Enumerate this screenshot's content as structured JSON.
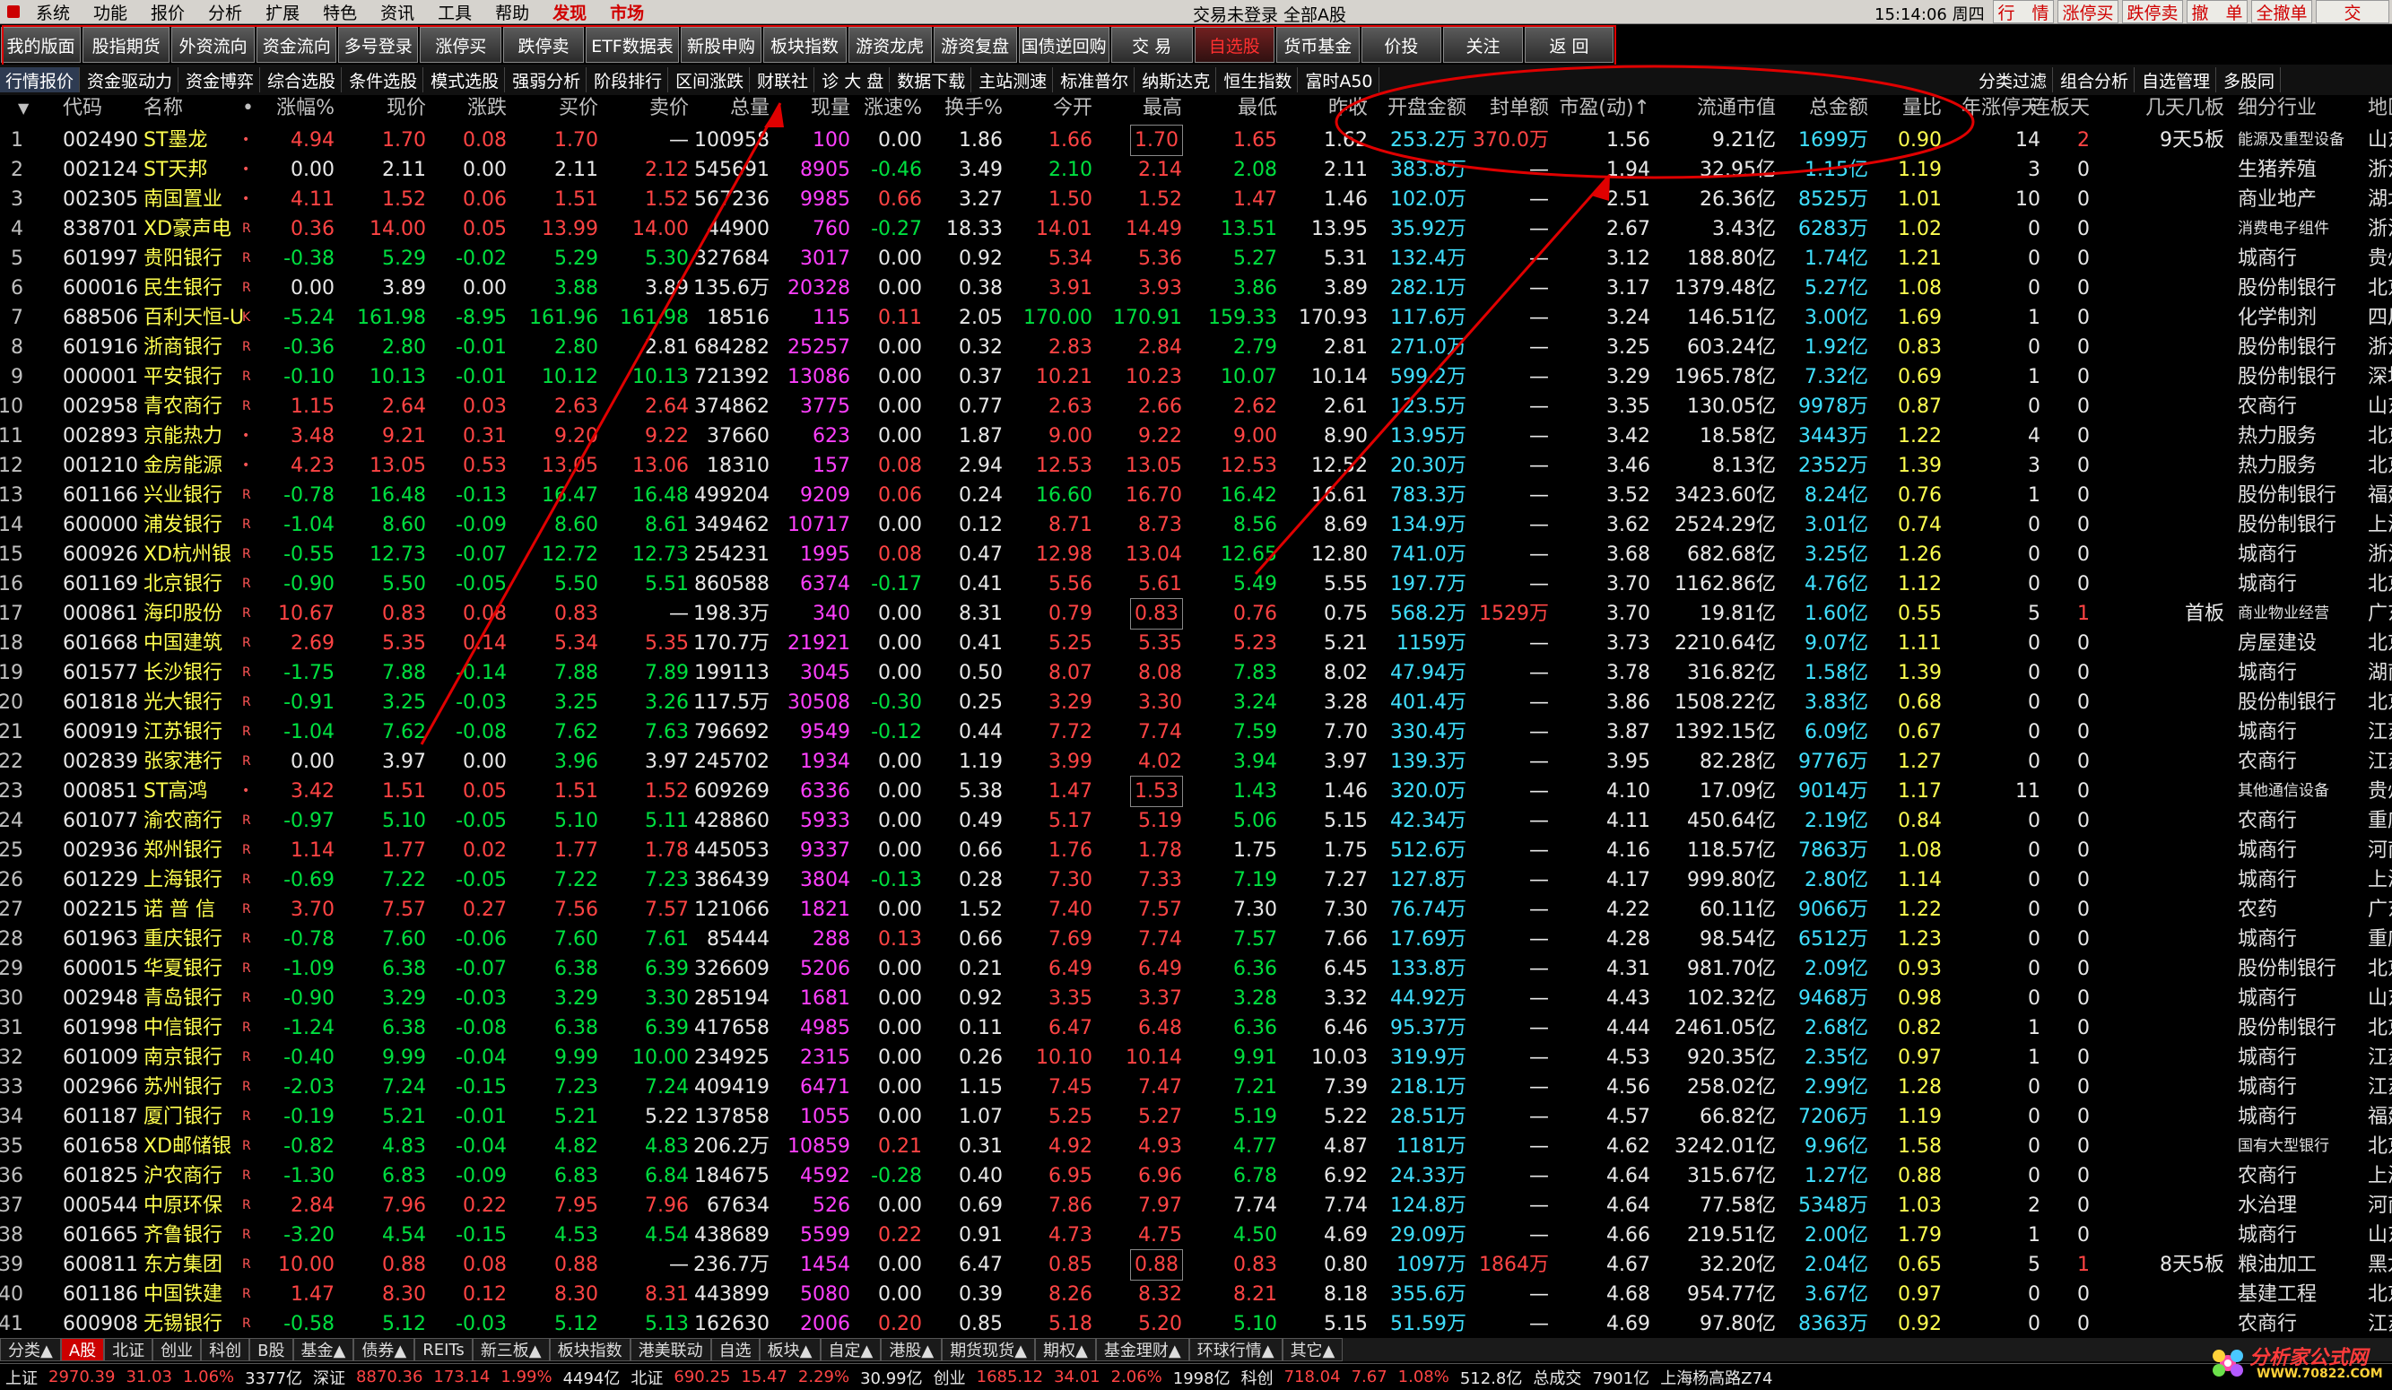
{
  "menubar": {
    "items": [
      "系统",
      "功能",
      "报价",
      "分析",
      "扩展",
      "特色",
      "资讯",
      "工具",
      "帮助",
      "发现",
      "市场"
    ],
    "red_items": [
      "发现",
      "市场"
    ],
    "title": "交易未登录  全部A股",
    "clock": "15:14:06 周四",
    "quick_buttons": [
      "行　情",
      "涨停买",
      "跌停卖",
      "撤　单",
      "全撤单",
      "交"
    ]
  },
  "toolbar1": {
    "buttons": [
      "我的版面",
      "股指期货",
      "外资流向",
      "资金流向",
      "多号登录",
      "涨停买",
      "跌停卖",
      "ETF数据表",
      "新股申购",
      "板块指数",
      "游资龙虎",
      "游资复盘",
      "国债逆回购",
      "交 易",
      "自选股",
      "货币基金",
      "价投",
      "关注",
      "返 回"
    ],
    "active": "自选股"
  },
  "toolbar2": {
    "buttons": [
      "行情报价",
      "资金驱动力",
      "资金博弈",
      "综合选股",
      "条件选股",
      "模式选股",
      "强弱分析",
      "阶段排行",
      "区间涨跌",
      "财联社",
      "诊 大 盘",
      "数据下载",
      "主站测速",
      "标准普尔",
      "纳斯达克",
      "恒生指数",
      "富时A50"
    ],
    "active": "行情报价",
    "right_buttons": [
      "分类过滤",
      "组合分析",
      "自选管理",
      "多股同"
    ]
  },
  "columns": [
    "",
    "代码",
    "名称",
    "•",
    "涨幅%",
    "现价",
    "涨跌",
    "买价",
    "卖价",
    "总量",
    "现量",
    "涨速%",
    "换手%",
    "今开",
    "最高",
    "最低",
    "昨收",
    "开盘金额",
    "封单额",
    "市盈(动)↑",
    "流通市值",
    "总金额",
    "量比",
    "年涨停天",
    "连板天",
    "几天几板",
    "细分行业",
    "地区"
  ],
  "rows": [
    [
      "1",
      "002490",
      "ST墨龙",
      "•",
      "4.94",
      "1.70",
      "0.08",
      "1.70",
      "—",
      "100958",
      "100",
      "0.00",
      "1.86",
      "1.66",
      "1.70",
      "1.65",
      "1.62",
      "253.2万",
      "370.0万",
      "1.56",
      "9.21亿",
      "1699万",
      "0.90",
      "14",
      "2",
      "9天5板",
      "能源及重型设备",
      "山东"
    ],
    [
      "2",
      "002124",
      "ST天邦",
      "•",
      "0.00",
      "2.11",
      "0.00",
      "2.11",
      "2.12",
      "545691",
      "8905",
      "-0.46",
      "3.49",
      "2.10",
      "2.14",
      "2.08",
      "2.11",
      "383.8万",
      "—",
      "1.94",
      "32.95亿",
      "1.15亿",
      "1.19",
      "3",
      "0",
      "",
      "生猪养殖",
      "浙江"
    ],
    [
      "3",
      "002305",
      "南国置业",
      "•",
      "4.11",
      "1.52",
      "0.06",
      "1.51",
      "1.52",
      "567236",
      "9985",
      "0.66",
      "3.27",
      "1.50",
      "1.52",
      "1.47",
      "1.46",
      "102.0万",
      "—",
      "2.51",
      "26.36亿",
      "8525万",
      "1.01",
      "10",
      "0",
      "",
      "商业地产",
      "湖北"
    ],
    [
      "4",
      "838701",
      "XD豪声电",
      "R",
      "0.36",
      "14.00",
      "0.05",
      "13.99",
      "14.00",
      "44900",
      "760",
      "-0.27",
      "18.33",
      "14.01",
      "14.49",
      "13.51",
      "13.95",
      "35.92万",
      "—",
      "2.67",
      "3.43亿",
      "6283万",
      "1.02",
      "0",
      "0",
      "",
      "消费电子组件",
      "浙江"
    ],
    [
      "5",
      "601997",
      "贵阳银行",
      "R",
      "-0.38",
      "5.29",
      "-0.02",
      "5.29",
      "5.30",
      "327684",
      "3017",
      "0.00",
      "0.92",
      "5.34",
      "5.36",
      "5.27",
      "5.31",
      "132.4万",
      "—",
      "3.12",
      "188.80亿",
      "1.74亿",
      "1.21",
      "0",
      "0",
      "",
      "城商行",
      "贵州"
    ],
    [
      "6",
      "600016",
      "民生银行",
      "R",
      "0.00",
      "3.89",
      "0.00",
      "3.88",
      "3.89",
      "135.6万",
      "20328",
      "0.00",
      "0.38",
      "3.91",
      "3.93",
      "3.86",
      "3.89",
      "282.1万",
      "—",
      "3.17",
      "1379.48亿",
      "5.27亿",
      "1.08",
      "0",
      "0",
      "",
      "股份制银行",
      "北京"
    ],
    [
      "7",
      "688506",
      "百利天恒-U",
      "K",
      "-5.24",
      "161.98",
      "-8.95",
      "161.96",
      "161.98",
      "18516",
      "115",
      "0.11",
      "2.05",
      "170.00",
      "170.91",
      "159.33",
      "170.93",
      "117.6万",
      "—",
      "3.24",
      "146.51亿",
      "3.00亿",
      "1.69",
      "1",
      "0",
      "",
      "化学制剂",
      "四川"
    ],
    [
      "8",
      "601916",
      "浙商银行",
      "R",
      "-0.36",
      "2.80",
      "-0.01",
      "2.80",
      "2.81",
      "684282",
      "25257",
      "0.00",
      "0.32",
      "2.83",
      "2.84",
      "2.79",
      "2.81",
      "271.0万",
      "—",
      "3.25",
      "603.24亿",
      "1.92亿",
      "0.83",
      "0",
      "0",
      "",
      "股份制银行",
      "浙江"
    ],
    [
      "9",
      "000001",
      "平安银行",
      "R",
      "-0.10",
      "10.13",
      "-0.01",
      "10.12",
      "10.13",
      "721392",
      "13086",
      "0.00",
      "0.37",
      "10.21",
      "10.23",
      "10.07",
      "10.14",
      "599.2万",
      "—",
      "3.29",
      "1965.78亿",
      "7.32亿",
      "0.69",
      "1",
      "0",
      "",
      "股份制银行",
      "深圳"
    ],
    [
      "10",
      "002958",
      "青农商行",
      "R",
      "1.15",
      "2.64",
      "0.03",
      "2.63",
      "2.64",
      "374862",
      "3775",
      "0.00",
      "0.77",
      "2.63",
      "2.66",
      "2.62",
      "2.61",
      "123.5万",
      "—",
      "3.35",
      "130.05亿",
      "9978万",
      "0.87",
      "0",
      "0",
      "",
      "农商行",
      "山东"
    ],
    [
      "11",
      "002893",
      "京能热力",
      "•",
      "3.48",
      "9.21",
      "0.31",
      "9.20",
      "9.22",
      "37660",
      "623",
      "0.00",
      "1.87",
      "9.00",
      "9.22",
      "9.00",
      "8.90",
      "13.95万",
      "—",
      "3.42",
      "18.58亿",
      "3443万",
      "1.22",
      "4",
      "0",
      "",
      "热力服务",
      "北京"
    ],
    [
      "12",
      "001210",
      "金房能源",
      "•",
      "4.23",
      "13.05",
      "0.53",
      "13.05",
      "13.06",
      "18310",
      "157",
      "0.08",
      "2.94",
      "12.53",
      "13.05",
      "12.53",
      "12.52",
      "20.30万",
      "—",
      "3.46",
      "8.13亿",
      "2352万",
      "1.39",
      "3",
      "0",
      "",
      "热力服务",
      "北京"
    ],
    [
      "13",
      "601166",
      "兴业银行",
      "R",
      "-0.78",
      "16.48",
      "-0.13",
      "16.47",
      "16.48",
      "499204",
      "9209",
      "0.06",
      "0.24",
      "16.60",
      "16.70",
      "16.42",
      "16.61",
      "783.3万",
      "—",
      "3.52",
      "3423.60亿",
      "8.24亿",
      "0.76",
      "1",
      "0",
      "",
      "股份制银行",
      "福建"
    ],
    [
      "14",
      "600000",
      "浦发银行",
      "R",
      "-1.04",
      "8.60",
      "-0.09",
      "8.60",
      "8.61",
      "349462",
      "10717",
      "0.00",
      "0.12",
      "8.71",
      "8.73",
      "8.56",
      "8.69",
      "134.9万",
      "—",
      "3.62",
      "2524.29亿",
      "3.01亿",
      "0.74",
      "0",
      "0",
      "",
      "股份制银行",
      "上海"
    ],
    [
      "15",
      "600926",
      "XD杭州银",
      "R",
      "-0.55",
      "12.73",
      "-0.07",
      "12.72",
      "12.73",
      "254231",
      "1995",
      "0.08",
      "0.47",
      "12.98",
      "13.04",
      "12.65",
      "12.80",
      "741.0万",
      "—",
      "3.68",
      "682.68亿",
      "3.25亿",
      "1.26",
      "0",
      "0",
      "",
      "城商行",
      "浙江"
    ],
    [
      "16",
      "601169",
      "北京银行",
      "R",
      "-0.90",
      "5.50",
      "-0.05",
      "5.50",
      "5.51",
      "860588",
      "6374",
      "-0.17",
      "0.41",
      "5.56",
      "5.61",
      "5.49",
      "5.55",
      "197.7万",
      "—",
      "3.70",
      "1162.86亿",
      "4.76亿",
      "1.12",
      "0",
      "0",
      "",
      "城商行",
      "北京"
    ],
    [
      "17",
      "000861",
      "海印股份",
      "R",
      "10.67",
      "0.83",
      "0.08",
      "0.83",
      "—",
      "198.3万",
      "340",
      "0.00",
      "8.31",
      "0.79",
      "0.83",
      "0.76",
      "0.75",
      "568.2万",
      "1529万",
      "3.70",
      "19.81亿",
      "1.60亿",
      "0.55",
      "5",
      "1",
      "首板",
      "商业物业经营",
      "广东"
    ],
    [
      "18",
      "601668",
      "中国建筑",
      "R",
      "2.69",
      "5.35",
      "0.14",
      "5.34",
      "5.35",
      "170.7万",
      "21921",
      "0.00",
      "0.41",
      "5.25",
      "5.35",
      "5.23",
      "5.21",
      "1159万",
      "—",
      "3.73",
      "2210.64亿",
      "9.07亿",
      "1.11",
      "0",
      "0",
      "",
      "房屋建设",
      "北京"
    ],
    [
      "19",
      "601577",
      "长沙银行",
      "R",
      "-1.75",
      "7.88",
      "-0.14",
      "7.88",
      "7.89",
      "199113",
      "3045",
      "0.00",
      "0.50",
      "8.07",
      "8.08",
      "7.83",
      "8.02",
      "47.94万",
      "—",
      "3.78",
      "316.82亿",
      "1.58亿",
      "1.39",
      "0",
      "0",
      "",
      "城商行",
      "湖南"
    ],
    [
      "20",
      "601818",
      "光大银行",
      "R",
      "-0.91",
      "3.25",
      "-0.03",
      "3.25",
      "3.26",
      "117.5万",
      "30508",
      "-0.30",
      "0.25",
      "3.29",
      "3.30",
      "3.24",
      "3.28",
      "401.4万",
      "—",
      "3.86",
      "1508.22亿",
      "3.83亿",
      "0.68",
      "0",
      "0",
      "",
      "股份制银行",
      "北京"
    ],
    [
      "21",
      "600919",
      "江苏银行",
      "R",
      "-1.04",
      "7.62",
      "-0.08",
      "7.62",
      "7.63",
      "796692",
      "9549",
      "-0.12",
      "0.44",
      "7.72",
      "7.74",
      "7.59",
      "7.70",
      "330.4万",
      "—",
      "3.87",
      "1392.15亿",
      "6.09亿",
      "0.67",
      "0",
      "0",
      "",
      "城商行",
      "江苏"
    ],
    [
      "22",
      "002839",
      "张家港行",
      "R",
      "0.00",
      "3.97",
      "0.00",
      "3.96",
      "3.97",
      "245702",
      "1934",
      "0.00",
      "1.19",
      "3.99",
      "4.02",
      "3.94",
      "3.97",
      "139.3万",
      "—",
      "3.95",
      "82.28亿",
      "9776万",
      "1.27",
      "0",
      "0",
      "",
      "农商行",
      "江苏"
    ],
    [
      "23",
      "000851",
      "ST高鸿",
      "•",
      "3.42",
      "1.51",
      "0.05",
      "1.51",
      "1.52",
      "609269",
      "6336",
      "0.00",
      "5.38",
      "1.47",
      "1.53",
      "1.43",
      "1.46",
      "320.0万",
      "—",
      "4.10",
      "17.09亿",
      "9014万",
      "1.17",
      "11",
      "0",
      "",
      "其他通信设备",
      "贵州"
    ],
    [
      "24",
      "601077",
      "渝农商行",
      "R",
      "-0.97",
      "5.10",
      "-0.05",
      "5.10",
      "5.11",
      "428860",
      "5933",
      "0.00",
      "0.49",
      "5.17",
      "5.19",
      "5.06",
      "5.15",
      "42.34万",
      "—",
      "4.11",
      "450.64亿",
      "2.19亿",
      "0.84",
      "0",
      "0",
      "",
      "农商行",
      "重庆"
    ],
    [
      "25",
      "002936",
      "郑州银行",
      "R",
      "1.14",
      "1.77",
      "0.02",
      "1.77",
      "1.78",
      "445053",
      "9337",
      "0.00",
      "0.66",
      "1.76",
      "1.78",
      "1.75",
      "1.75",
      "512.6万",
      "—",
      "4.16",
      "118.57亿",
      "7863万",
      "1.08",
      "0",
      "0",
      "",
      "城商行",
      "河南"
    ],
    [
      "26",
      "601229",
      "上海银行",
      "R",
      "-0.69",
      "7.22",
      "-0.05",
      "7.22",
      "7.23",
      "386439",
      "3804",
      "-0.13",
      "0.28",
      "7.30",
      "7.33",
      "7.19",
      "7.27",
      "127.8万",
      "—",
      "4.17",
      "999.80亿",
      "2.80亿",
      "1.14",
      "0",
      "0",
      "",
      "城商行",
      "上海"
    ],
    [
      "27",
      "002215",
      "诺 普 信",
      "R",
      "3.70",
      "7.57",
      "0.27",
      "7.56",
      "7.57",
      "121066",
      "1821",
      "0.00",
      "1.52",
      "7.40",
      "7.57",
      "7.30",
      "7.30",
      "76.74万",
      "—",
      "4.22",
      "60.11亿",
      "9066万",
      "1.22",
      "0",
      "0",
      "",
      "农药",
      "广东"
    ],
    [
      "28",
      "601963",
      "重庆银行",
      "R",
      "-0.78",
      "7.60",
      "-0.06",
      "7.60",
      "7.61",
      "85444",
      "288",
      "0.13",
      "0.66",
      "7.69",
      "7.74",
      "7.57",
      "7.66",
      "17.69万",
      "—",
      "4.28",
      "98.54亿",
      "6512万",
      "1.23",
      "0",
      "0",
      "",
      "城商行",
      "重庆"
    ],
    [
      "29",
      "600015",
      "华夏银行",
      "R",
      "-1.09",
      "6.38",
      "-0.07",
      "6.38",
      "6.39",
      "326609",
      "5206",
      "0.00",
      "0.21",
      "6.49",
      "6.49",
      "6.36",
      "6.45",
      "133.8万",
      "—",
      "4.31",
      "981.70亿",
      "2.09亿",
      "0.93",
      "0",
      "0",
      "",
      "股份制银行",
      "北京"
    ],
    [
      "30",
      "002948",
      "青岛银行",
      "R",
      "-0.90",
      "3.29",
      "-0.03",
      "3.29",
      "3.30",
      "285194",
      "1681",
      "0.00",
      "0.92",
      "3.35",
      "3.37",
      "3.28",
      "3.32",
      "44.92万",
      "—",
      "4.43",
      "102.32亿",
      "9468万",
      "0.98",
      "0",
      "0",
      "",
      "城商行",
      "山东"
    ],
    [
      "31",
      "601998",
      "中信银行",
      "R",
      "-1.24",
      "6.38",
      "-0.08",
      "6.38",
      "6.39",
      "417658",
      "4985",
      "0.00",
      "0.11",
      "6.47",
      "6.48",
      "6.36",
      "6.46",
      "95.37万",
      "—",
      "4.44",
      "2461.05亿",
      "2.68亿",
      "0.82",
      "1",
      "0",
      "",
      "股份制银行",
      "北京"
    ],
    [
      "32",
      "601009",
      "南京银行",
      "R",
      "-0.40",
      "9.99",
      "-0.04",
      "9.99",
      "10.00",
      "234925",
      "2315",
      "0.00",
      "0.26",
      "10.10",
      "10.14",
      "9.91",
      "10.03",
      "319.9万",
      "—",
      "4.53",
      "920.35亿",
      "2.35亿",
      "0.97",
      "1",
      "0",
      "",
      "城商行",
      "江苏"
    ],
    [
      "33",
      "002966",
      "苏州银行",
      "R",
      "-2.03",
      "7.24",
      "-0.15",
      "7.23",
      "7.24",
      "409419",
      "6471",
      "0.00",
      "1.15",
      "7.45",
      "7.47",
      "7.21",
      "7.39",
      "218.1万",
      "—",
      "4.56",
      "258.02亿",
      "2.99亿",
      "1.28",
      "0",
      "0",
      "",
      "城商行",
      "江苏"
    ],
    [
      "34",
      "601187",
      "厦门银行",
      "R",
      "-0.19",
      "5.21",
      "-0.01",
      "5.21",
      "5.22",
      "137858",
      "1055",
      "0.00",
      "1.07",
      "5.25",
      "5.27",
      "5.19",
      "5.22",
      "28.51万",
      "—",
      "4.57",
      "66.82亿",
      "7206万",
      "1.19",
      "0",
      "0",
      "",
      "城商行",
      "福建"
    ],
    [
      "35",
      "601658",
      "XD邮储银",
      "R",
      "-0.82",
      "4.83",
      "-0.04",
      "4.82",
      "4.83",
      "206.2万",
      "10859",
      "0.21",
      "0.31",
      "4.92",
      "4.93",
      "4.77",
      "4.87",
      "1181万",
      "—",
      "4.62",
      "3242.01亿",
      "9.96亿",
      "1.58",
      "0",
      "0",
      "",
      "国有大型银行",
      "北京"
    ],
    [
      "36",
      "601825",
      "沪农商行",
      "R",
      "-1.30",
      "6.83",
      "-0.09",
      "6.83",
      "6.84",
      "184675",
      "4592",
      "-0.28",
      "0.40",
      "6.95",
      "6.96",
      "6.78",
      "6.92",
      "24.33万",
      "—",
      "4.64",
      "315.67亿",
      "1.27亿",
      "0.88",
      "0",
      "0",
      "",
      "农商行",
      "上海"
    ],
    [
      "37",
      "000544",
      "中原环保",
      "R",
      "2.84",
      "7.96",
      "0.22",
      "7.95",
      "7.96",
      "67634",
      "526",
      "0.00",
      "0.69",
      "7.86",
      "7.97",
      "7.74",
      "7.74",
      "124.8万",
      "—",
      "4.64",
      "77.58亿",
      "5348万",
      "1.03",
      "2",
      "0",
      "",
      "水治理",
      "河南"
    ],
    [
      "38",
      "601665",
      "齐鲁银行",
      "R",
      "-3.20",
      "4.54",
      "-0.15",
      "4.53",
      "4.54",
      "438689",
      "5599",
      "0.22",
      "0.91",
      "4.73",
      "4.75",
      "4.50",
      "4.69",
      "29.09万",
      "—",
      "4.66",
      "219.51亿",
      "2.00亿",
      "1.79",
      "1",
      "0",
      "",
      "城商行",
      "山东"
    ],
    [
      "39",
      "600811",
      "东方集团",
      "R",
      "10.00",
      "0.88",
      "0.08",
      "0.88",
      "—",
      "236.7万",
      "1454",
      "0.00",
      "6.47",
      "0.85",
      "0.88",
      "0.83",
      "0.80",
      "1097万",
      "1864万",
      "4.67",
      "32.20亿",
      "2.04亿",
      "0.65",
      "5",
      "1",
      "8天5板",
      "粮油加工",
      "黑龙江"
    ],
    [
      "40",
      "601186",
      "中国铁建",
      "R",
      "1.47",
      "8.30",
      "0.12",
      "8.30",
      "8.31",
      "443899",
      "5080",
      "0.00",
      "0.39",
      "8.26",
      "8.32",
      "8.21",
      "8.18",
      "355.6万",
      "—",
      "4.68",
      "954.77亿",
      "3.67亿",
      "0.97",
      "0",
      "0",
      "",
      "基建工程",
      "北京"
    ],
    [
      "41",
      "600908",
      "无锡银行",
      "R",
      "-0.58",
      "5.12",
      "-0.03",
      "5.12",
      "5.13",
      "162630",
      "2006",
      "0.20",
      "0.85",
      "5.18",
      "5.20",
      "5.10",
      "5.15",
      "51.59万",
      "—",
      "4.69",
      "97.80亿",
      "8363万",
      "0.92",
      "0",
      "0",
      "",
      "农商行",
      "江苏"
    ]
  ],
  "bottom_tabs": [
    "分类▲",
    "A股",
    "北证",
    "创业",
    "科创",
    "B股",
    "基金▲",
    "债券▲",
    "REITs",
    "新三板▲",
    "板块指数",
    "港美联动",
    "自选",
    "板块▲",
    "自定▲",
    "港股▲",
    "期货现货▲",
    "期权▲",
    "基金理财▲",
    "环球行情▲",
    "其它▲"
  ],
  "bottom_active": "A股",
  "status": {
    "sh_label": "上证",
    "sh_index": "2970.39",
    "sh_change": "31.03",
    "sh_pct": "1.06%",
    "sh_amount": "3377亿",
    "sz_label": "深证",
    "sz_index": "8870.36",
    "sz_change": "173.14",
    "sz_pct": "1.99%",
    "sz_amount": "4494亿",
    "bz_label": "北证",
    "bz_index": "690.25",
    "bz_change": "15.47",
    "bz_pct": "2.29%",
    "bz_amount": "30.99亿",
    "cy_label": "创业",
    "cy_index": "1685.12",
    "cy_change": "34.01",
    "cy_pct": "2.06%",
    "cy_amount": "1998亿",
    "kc_label": "科创",
    "kc_index": "718.04",
    "kc_change": "7.67",
    "kc_pct": "1.08%",
    "kc_amount": "512.8亿",
    "total_label": "总成交",
    "total_value": "7901亿",
    "server": "上海杨高路Z74"
  },
  "logo": {
    "text": "分析家公式网",
    "url_text": "WWW.70822.COM"
  },
  "colors": {
    "up": "#ff4444",
    "down": "#00e040",
    "name": "#ffff50",
    "volume": "#ff40ff",
    "amount": "#40e0ff",
    "annotation": "#e00000"
  }
}
